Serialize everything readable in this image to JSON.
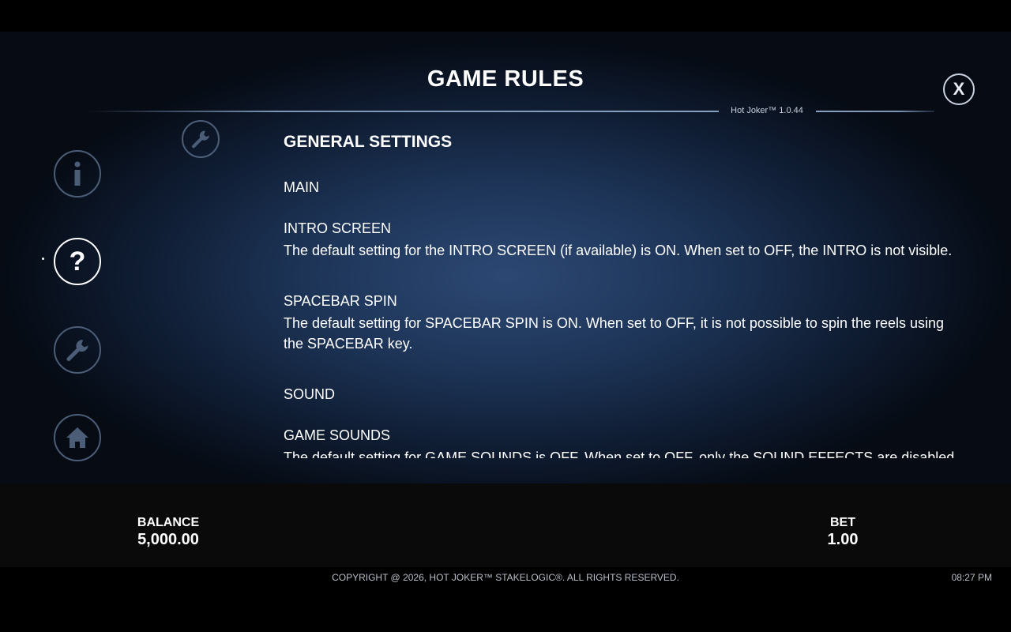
{
  "title": "GAME RULES",
  "close_label": "X",
  "version": "Hot Joker™ 1.0.44",
  "nav": [
    {
      "name": "info",
      "icon": "info-icon",
      "glyph": "i",
      "active": false
    },
    {
      "name": "help",
      "icon": "question-icon",
      "glyph": "?",
      "active": true
    },
    {
      "name": "settings",
      "icon": "wrench-icon",
      "active": false
    },
    {
      "name": "home",
      "icon": "home-icon",
      "active": false
    }
  ],
  "content": {
    "section_title": "GENERAL SETTINGS",
    "main": "MAIN",
    "intro_title": "INTRO SCREEN",
    "intro_text": "The default setting for the INTRO SCREEN (if available) is ON. When set to OFF, the INTRO is not visible.",
    "spacebar_title": "SPACEBAR SPIN",
    "spacebar_text": "The default setting for SPACEBAR SPIN is ON. When set to OFF, it is not possible to spin the reels using the SPACEBAR key.",
    "sound": "SOUND",
    "game_sounds_title": "GAME SOUNDS",
    "game_sounds_text": "The default setting for GAME SOUNDS is OFF. When set to OFF, only the SOUND EFFECTS are disabled."
  },
  "balance": {
    "label": "BALANCE",
    "value": "5,000.00"
  },
  "bet": {
    "label": "BET",
    "value": "1.00"
  },
  "footer": {
    "copyright": "COPYRIGHT @ 2026, HOT JOKER™ STAKELOGIC®. ALL RIGHTS RESERVED.",
    "time": "08:27 PM"
  },
  "colors": {
    "panel": "#1d3457",
    "accent_border": "#4b5d77",
    "active_border": "#ffffff"
  }
}
